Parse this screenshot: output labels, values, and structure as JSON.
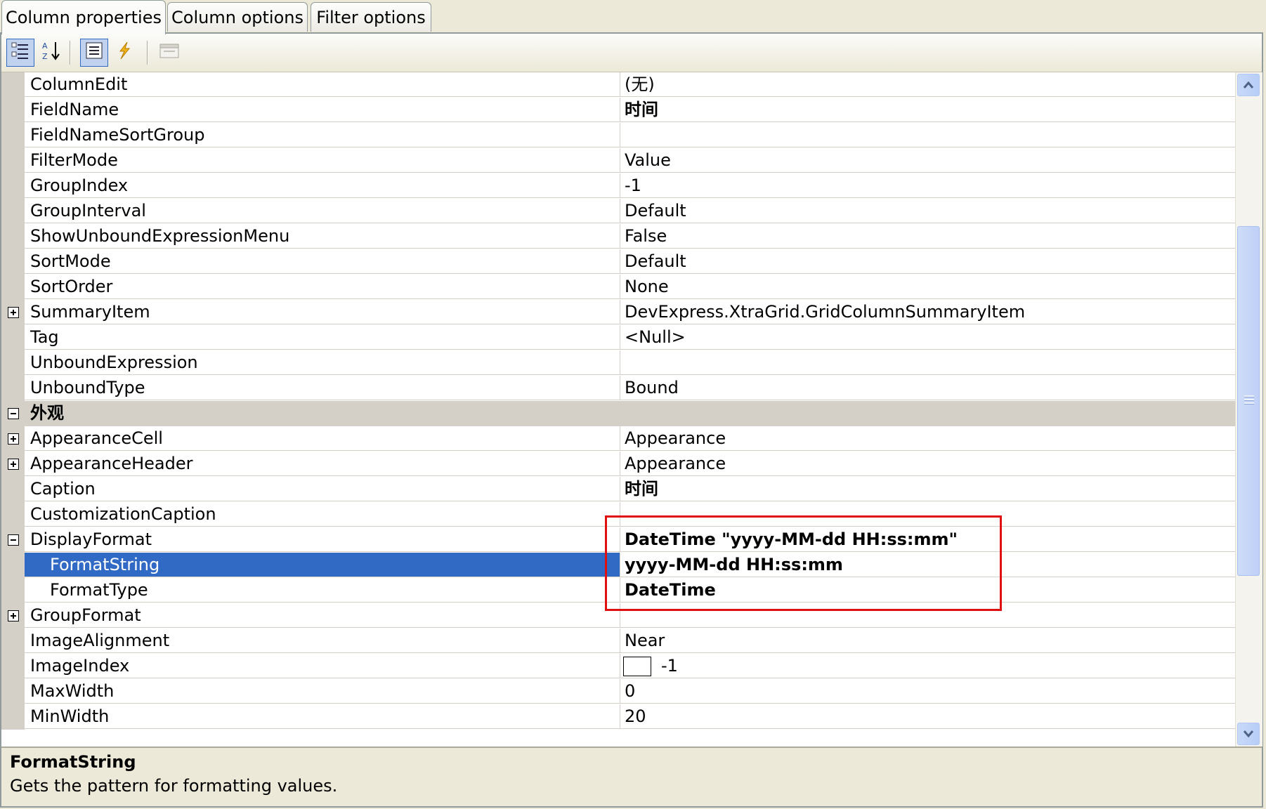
{
  "tabs": [
    {
      "label": "Column properties",
      "active": true
    },
    {
      "label": "Column options",
      "active": false
    },
    {
      "label": "Filter options",
      "active": false
    }
  ],
  "toolbar": {
    "buttons": [
      {
        "icon": "categorized-icon",
        "pressed": true
      },
      {
        "icon": "sort-alphabetical-icon",
        "pressed": false
      },
      {
        "icon": "properties-icon",
        "pressed": true
      },
      {
        "icon": "events-lightning-icon",
        "pressed": false
      },
      {
        "icon": "property-pages-icon",
        "pressed": false,
        "disabled": true
      }
    ]
  },
  "rows": [
    {
      "name": "ColumnEdit",
      "value": "(无)"
    },
    {
      "name": "FieldName",
      "value": "时间",
      "bold": true
    },
    {
      "name": "FieldNameSortGroup",
      "value": ""
    },
    {
      "name": "FilterMode",
      "value": "Value"
    },
    {
      "name": "GroupIndex",
      "value": "-1"
    },
    {
      "name": "GroupInterval",
      "value": "Default"
    },
    {
      "name": "ShowUnboundExpressionMenu",
      "value": "False"
    },
    {
      "name": "SortMode",
      "value": "Default"
    },
    {
      "name": "SortOrder",
      "value": "None"
    },
    {
      "name": "SummaryItem",
      "value": "DevExpress.XtraGrid.GridColumnSummaryItem",
      "expander": "plus"
    },
    {
      "name": "Tag",
      "value": "<Null>"
    },
    {
      "name": "UnboundExpression",
      "value": ""
    },
    {
      "name": "UnboundType",
      "value": "Bound"
    },
    {
      "name": "外观",
      "category": true,
      "expander": "minus"
    },
    {
      "name": "AppearanceCell",
      "value": "Appearance",
      "expander": "plus"
    },
    {
      "name": "AppearanceHeader",
      "value": "Appearance",
      "expander": "plus"
    },
    {
      "name": "Caption",
      "value": "时间",
      "bold": true
    },
    {
      "name": "CustomizationCaption",
      "value": ""
    },
    {
      "name": "DisplayFormat",
      "value": "DateTime \"yyyy-MM-dd HH:ss:mm\"",
      "bold": true,
      "expander": "minus"
    },
    {
      "name": "FormatString",
      "value": "yyyy-MM-dd HH:ss:mm",
      "bold": true,
      "indent": true,
      "selected": true
    },
    {
      "name": "FormatType",
      "value": "DateTime",
      "bold": true,
      "indent": true
    },
    {
      "name": "GroupFormat",
      "value": "",
      "expander": "plus"
    },
    {
      "name": "ImageAlignment",
      "value": "Near"
    },
    {
      "name": "ImageIndex",
      "value": "-1",
      "imageBox": true
    },
    {
      "name": "MaxWidth",
      "value": "0"
    },
    {
      "name": "MinWidth",
      "value": "20"
    }
  ],
  "help": {
    "title": "FormatString",
    "description": "Gets the pattern for formatting values."
  },
  "colors": {
    "selection": "#316ac5",
    "highlight_border": "#e01010",
    "gutter": "#d4d0c8",
    "window_bg": "#ece9d8"
  }
}
